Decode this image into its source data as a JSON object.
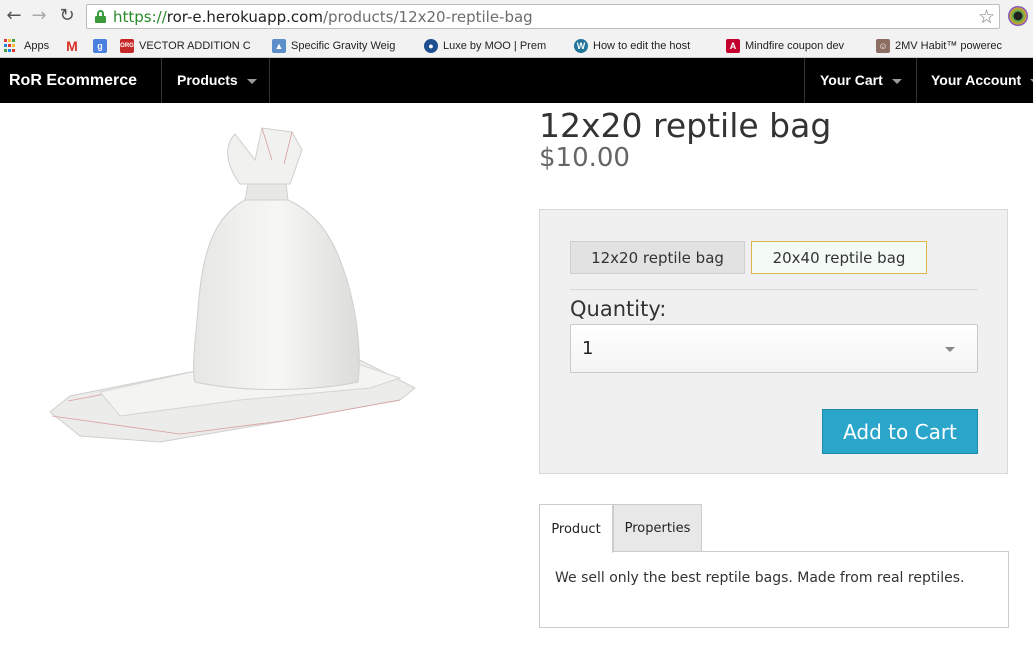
{
  "browser": {
    "url_scheme": "https://",
    "url_host": "ror-e.herokuapp.com",
    "url_path": "/products/12x20-reptile-bag",
    "bookmarks": [
      {
        "label": "Apps",
        "icon": "apps-grid-icon"
      },
      {
        "label": "",
        "icon": "gmail-icon"
      },
      {
        "label": "",
        "icon": "google-icon"
      },
      {
        "label": "VECTOR ADDITION C",
        "icon": "org-icon"
      },
      {
        "label": "Specific Gravity Weig",
        "icon": "page-icon"
      },
      {
        "label": "Luxe by MOO | Prem",
        "icon": "moo-icon"
      },
      {
        "label": "How to edit the host",
        "icon": "wordpress-icon"
      },
      {
        "label": "Mindfire coupon dev",
        "icon": "angular-icon"
      },
      {
        "label": "2MV Habit™ powerec",
        "icon": "habit-icon"
      }
    ]
  },
  "navbar": {
    "brand": "RoR Ecommerce",
    "products": "Products",
    "cart": "Your Cart",
    "account": "Your Account"
  },
  "product": {
    "image_icon": "reptile-bag-image",
    "title": "12x20 reptile bag",
    "price": "$10.00",
    "variants": [
      "12x20 reptile bag",
      "20x40 reptile bag"
    ],
    "quantity_label": "Quantity:",
    "quantity_value": "1",
    "add_to_cart": "Add to Cart"
  },
  "tabs": {
    "items": [
      "Product",
      "Properties"
    ],
    "active": "Product",
    "content": "We sell only the best reptile bags. Made from real reptiles."
  },
  "colors": {
    "navbar_bg": "#000000",
    "button_bg": "#2ba6cb",
    "selected_variant_border": "#e0b34a",
    "secure_url": "#2a8a2a"
  }
}
